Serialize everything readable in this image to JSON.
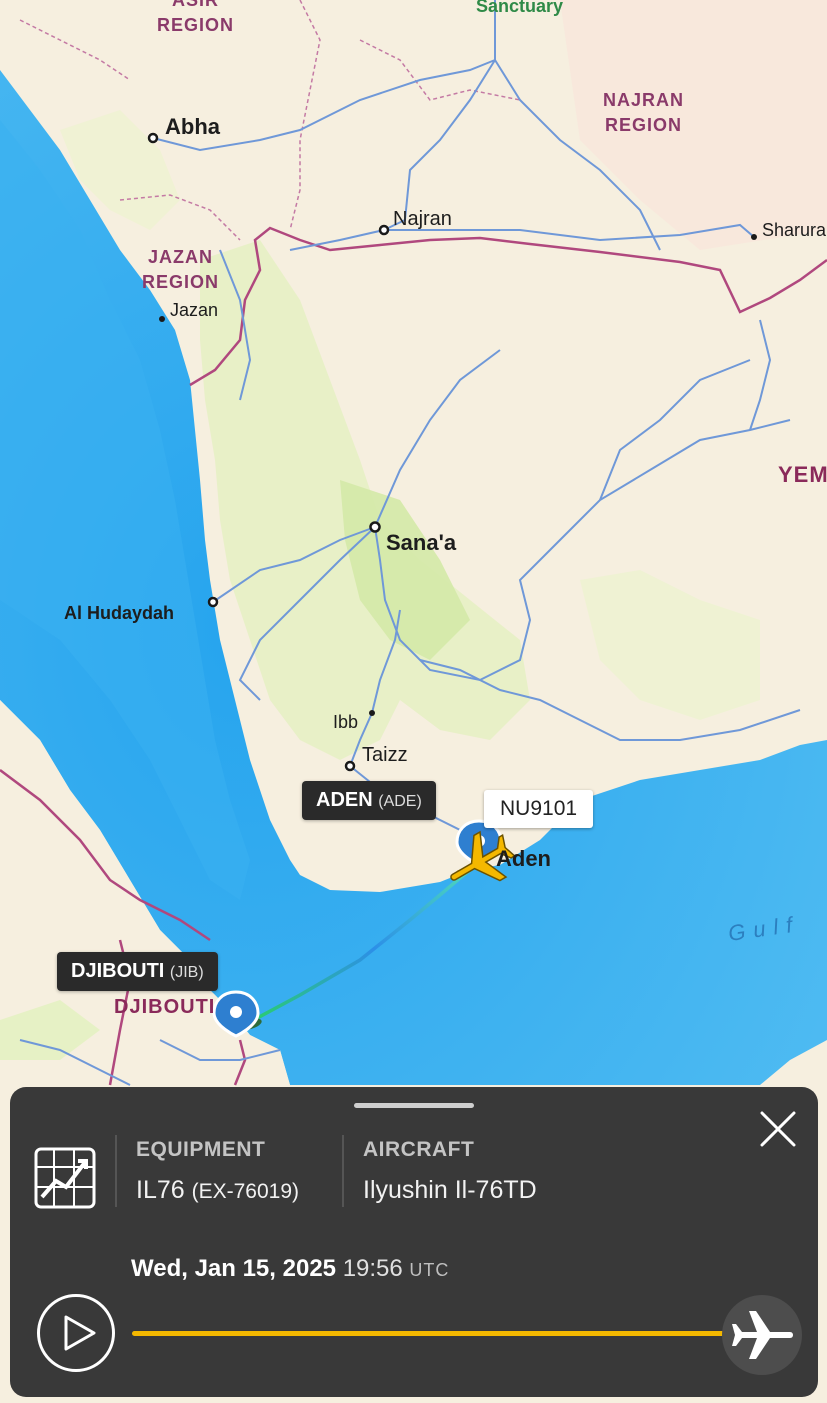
{
  "map": {
    "regions": {
      "asir": "ASIR\nREGION",
      "najran": "NAJRAN\nREGION",
      "jazan": "JAZAN\nREGION",
      "djibouti_country": "DJIBOUTI",
      "yemen_country": "YEM"
    },
    "cities": {
      "sanctuary": "Sanctuary",
      "abha": "Abha",
      "najran": "Najran",
      "sharura": "Sharura",
      "jazan": "Jazan",
      "sanaa": "Sana'a",
      "al_hudaydah": "Al Hudaydah",
      "ibb": "Ibb",
      "taizz": "Taizz",
      "aden": "Aden"
    },
    "water": {
      "gulf": "Gulf"
    },
    "airports": {
      "origin": {
        "name": "DJIBOUTI",
        "code": "(JIB)"
      },
      "destination": {
        "name": "ADEN",
        "code": "(ADE)"
      }
    },
    "flight": {
      "callsign": "NU9101",
      "status_color": "#f4b800"
    }
  },
  "panel": {
    "equipment": {
      "label": "EQUIPMENT",
      "type": "IL76",
      "registration": "(EX-76019)"
    },
    "aircraft": {
      "label": "AIRCRAFT",
      "model": "Ilyushin Il-76TD"
    },
    "playback": {
      "date": "Wed, Jan 15, 2025",
      "time": "19:56",
      "timezone": "UTC",
      "progress": 1.0
    },
    "icons": {
      "equipment": "flight-chart-icon",
      "close": "close-icon",
      "play": "play-icon",
      "scrub": "airplane-icon"
    }
  }
}
